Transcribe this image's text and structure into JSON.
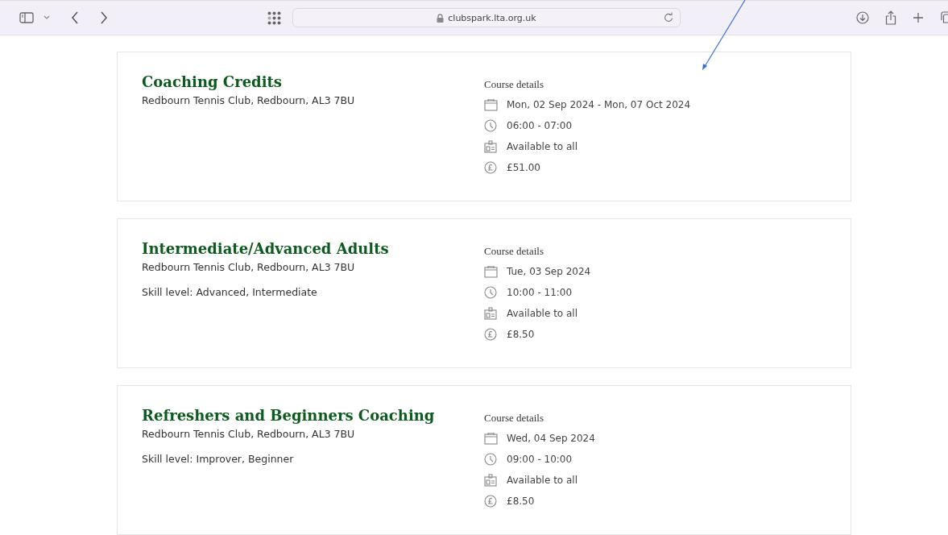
{
  "browser": {
    "url": "clubspark.lta.org.uk"
  },
  "courses": [
    {
      "title": "Coaching Credits",
      "venue": "Redbourn Tennis Club, Redbourn, AL3 7BU",
      "details_heading": "Course details",
      "details": [
        {
          "kind": "date",
          "text": "Mon, 02 Sep 2024 - Mon, 07 Oct 2024"
        },
        {
          "kind": "time",
          "text": "06:00 - 07:00"
        },
        {
          "kind": "availability",
          "text": "Available to all"
        },
        {
          "kind": "price",
          "text": "£51.00"
        }
      ]
    },
    {
      "title": "Intermediate/Advanced Adults",
      "venue": "Redbourn Tennis Club, Redbourn, AL3 7BU",
      "skill_level": "Skill level: Advanced, Intermediate",
      "details_heading": "Course details",
      "details": [
        {
          "kind": "date",
          "text": "Tue, 03 Sep 2024"
        },
        {
          "kind": "time",
          "text": "10:00 - 11:00"
        },
        {
          "kind": "availability",
          "text": "Available to all"
        },
        {
          "kind": "price",
          "text": "£8.50"
        }
      ]
    },
    {
      "title": "Refreshers and Beginners Coaching",
      "venue": "Redbourn Tennis Club, Redbourn, AL3 7BU",
      "skill_level": "Skill level: Improver, Beginner",
      "details_heading": "Course details",
      "details": [
        {
          "kind": "date",
          "text": "Wed, 04 Sep 2024"
        },
        {
          "kind": "time",
          "text": "09:00 - 10:00"
        },
        {
          "kind": "availability",
          "text": "Available to all"
        },
        {
          "kind": "price",
          "text": "£8.50"
        }
      ]
    }
  ],
  "annotations": [
    {
      "kind": "arrow"
    }
  ]
}
